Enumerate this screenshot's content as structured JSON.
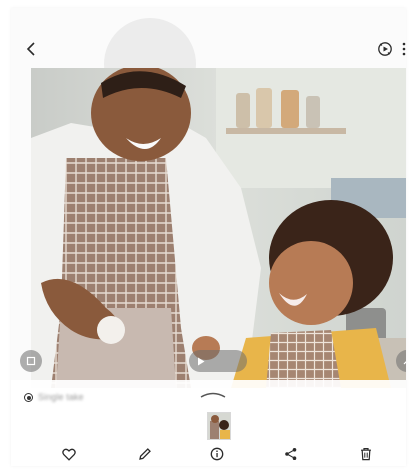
{
  "header": {
    "back_icon": "chevron-left-icon",
    "motion_icon": "motion-photo-icon",
    "more_icon": "more-vertical-icon"
  },
  "photo": {
    "subject": "photo-of-father-and-child-in-kitchen"
  },
  "overlay_controls": {
    "left_icon": "crop-icon",
    "video_icon": "play-icon",
    "right_icon": "settings-icon"
  },
  "panel": {
    "recommendation_label": "Single take",
    "selected": true
  },
  "bottom_bar": {
    "items": [
      {
        "icon": "heart-icon"
      },
      {
        "icon": "edit-pencil-icon"
      },
      {
        "icon": "info-icon"
      },
      {
        "icon": "share-icon"
      },
      {
        "icon": "delete-icon"
      }
    ]
  },
  "colors": {
    "icon": "#2b2b2b",
    "background": "#fbfbfb",
    "overlay_button": "#6e6e6e"
  }
}
